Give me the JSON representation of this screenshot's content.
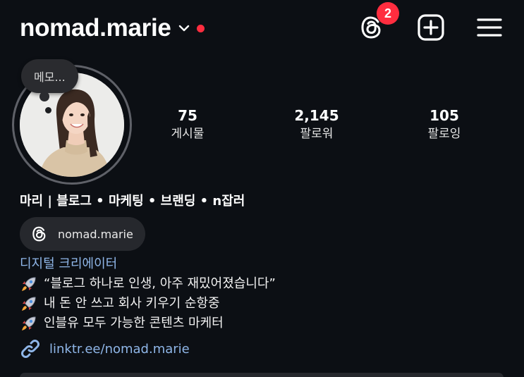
{
  "header": {
    "username": "nomad.marie",
    "threads_badge_count": "2",
    "colors": {
      "badge": "#ff2d3f",
      "status_dot": "#ff2d3f"
    },
    "icons": [
      "chevron-down-icon",
      "threads-icon",
      "add-square-icon",
      "hamburger-menu-icon"
    ]
  },
  "note": {
    "text": "메모..."
  },
  "stats": [
    {
      "value": "75",
      "label": "게시물"
    },
    {
      "value": "2,145",
      "label": "팔로워"
    },
    {
      "value": "105",
      "label": "팔로잉"
    }
  ],
  "profile": {
    "display_name": "마리 | 블로그 • 마케팅 • 브랜딩 • n잡러",
    "threads_handle": "nomad.marie",
    "category": "디지털 크리에이터",
    "bio_lines": [
      "“블로그 하나로 인생, 아주 재밌어졌습니다”",
      "내 돈 안 쓰고 회사 키우기 순항중",
      "인블유 모두 가능한 콘텐츠 마케터"
    ],
    "link": "linktr.ee/nomad.marie",
    "colors": {
      "link": "#8fb6e8",
      "category": "#8fb6e8"
    }
  }
}
